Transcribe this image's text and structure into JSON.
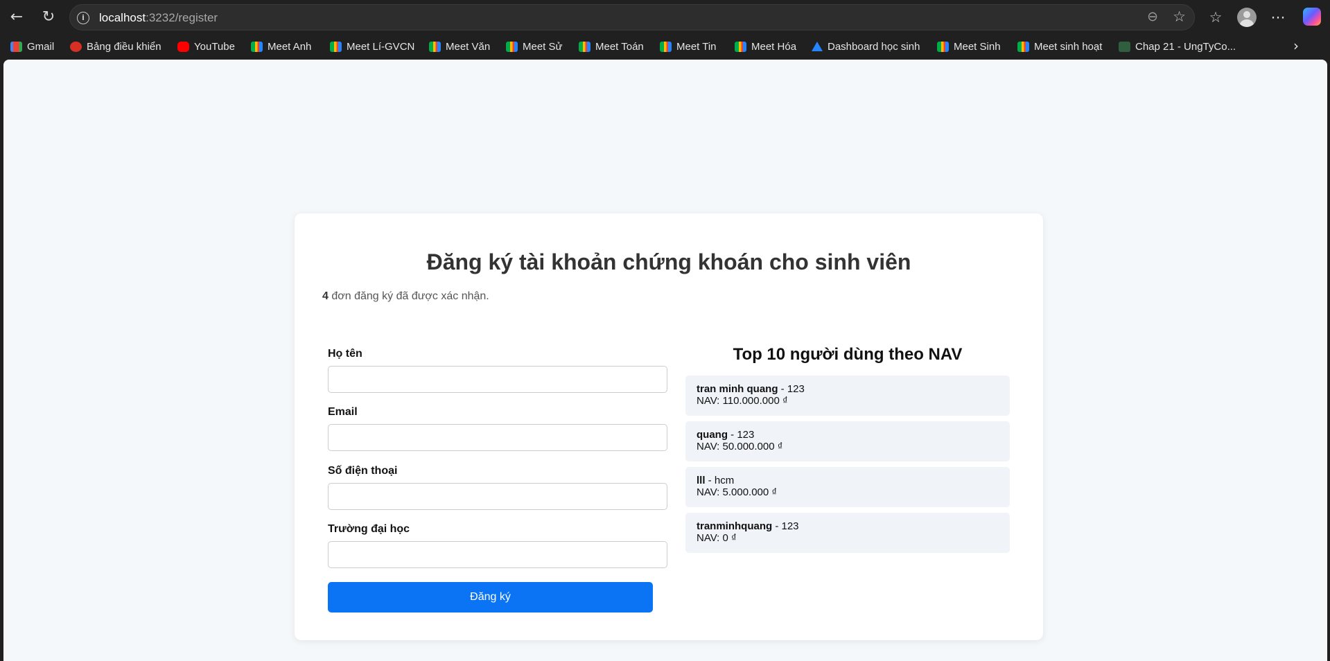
{
  "browser": {
    "url_host": "localhost",
    "url_rest": ":3232/register",
    "icons": {
      "back": "back-arrow-icon",
      "reload": "reload-icon",
      "info": "site-info-icon",
      "zoom": "zoom-icon",
      "favorite": "star-icon",
      "favorites": "favorites-icon",
      "profile": "profile-icon",
      "menu": "more-icon",
      "copilot": "copilot-icon"
    }
  },
  "bookmarks": [
    {
      "label": "Gmail",
      "icon": "gmail"
    },
    {
      "label": "Bảng điều khiển",
      "icon": "dash"
    },
    {
      "label": "YouTube",
      "icon": "yt"
    },
    {
      "label": "Meet Anh",
      "icon": "meet"
    },
    {
      "label": "Meet Lí-GVCN",
      "icon": "meet"
    },
    {
      "label": "Meet Văn",
      "icon": "meet"
    },
    {
      "label": "Meet Sử",
      "icon": "meet"
    },
    {
      "label": "Meet Toán",
      "icon": "meet"
    },
    {
      "label": "Meet Tin",
      "icon": "meet"
    },
    {
      "label": "Meet Hóa",
      "icon": "meet"
    },
    {
      "label": "Dashboard học sinh",
      "icon": "drive"
    },
    {
      "label": "Meet Sinh",
      "icon": "meet"
    },
    {
      "label": "Meet sinh hoạt",
      "icon": "meet"
    },
    {
      "label": "Chap 21 - UngTyCo...",
      "icon": "chap"
    }
  ],
  "page": {
    "title": "Đăng ký tài khoản chứng khoán cho sinh viên",
    "confirm_count": "4",
    "confirm_text": " đơn đăng ký đã được xác nhận.",
    "form": {
      "name_label": "Họ tên",
      "email_label": "Email",
      "phone_label": "Số điện thoại",
      "school_label": "Trường đại học",
      "name_value": "",
      "email_value": "",
      "phone_value": "",
      "school_value": "",
      "submit_label": "Đăng ký"
    },
    "top_users": {
      "title": "Top 10 người dùng theo NAV",
      "items": [
        {
          "name": "tran minh quang",
          "school": " - 123",
          "nav": "NAV: 110.000.000 ₫"
        },
        {
          "name": "quang",
          "school": " - 123",
          "nav": "NAV: 50.000.000 ₫"
        },
        {
          "name": "lll",
          "school": " - hcm",
          "nav": "NAV: 5.000.000 ₫"
        },
        {
          "name": "tranminhquang",
          "school": " - 123",
          "nav": "NAV: 0 ₫"
        }
      ]
    }
  },
  "colors": {
    "primary_button": "#0a74f5",
    "page_background": "#f5f8fb",
    "list_item_background": "#f0f3f8"
  }
}
